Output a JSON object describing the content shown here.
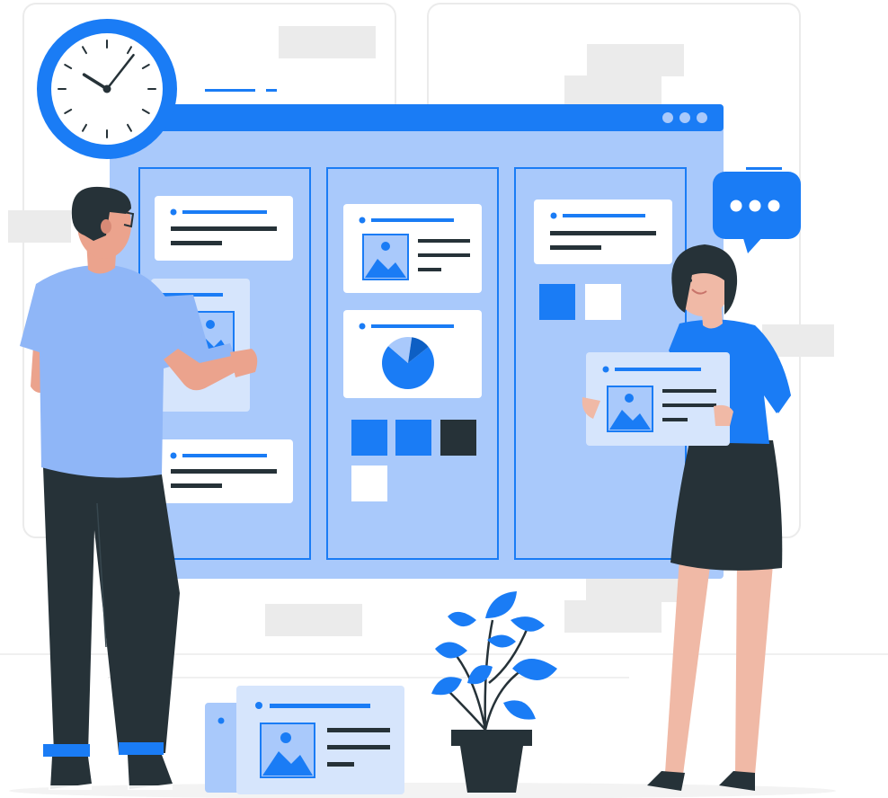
{
  "colors": {
    "accent": "#1a7cf5",
    "board_fill": "#a9c9fb",
    "board_bar": "#1a7cf5",
    "card": "#ffffff",
    "light_card": "#d6e5fc",
    "dark": "#263238",
    "skin": "#eba38d",
    "shirt_man": "#8fb6f7",
    "background_frame": "#ebebeb",
    "placeholder": "#ebebeb"
  },
  "icons": {
    "clock": "wall-clock-icon",
    "chat": "chat-bubble-dots-icon",
    "image": "image-placeholder-icon",
    "pie": "pie-chart-icon",
    "window_dots": "window-dots-icon"
  },
  "clock": {
    "hour": 10,
    "minute": 4
  },
  "pie_chart": {
    "slices": [
      0.72,
      0.16,
      0.12
    ]
  },
  "board": {
    "columns": 3,
    "window_dots": 3
  }
}
